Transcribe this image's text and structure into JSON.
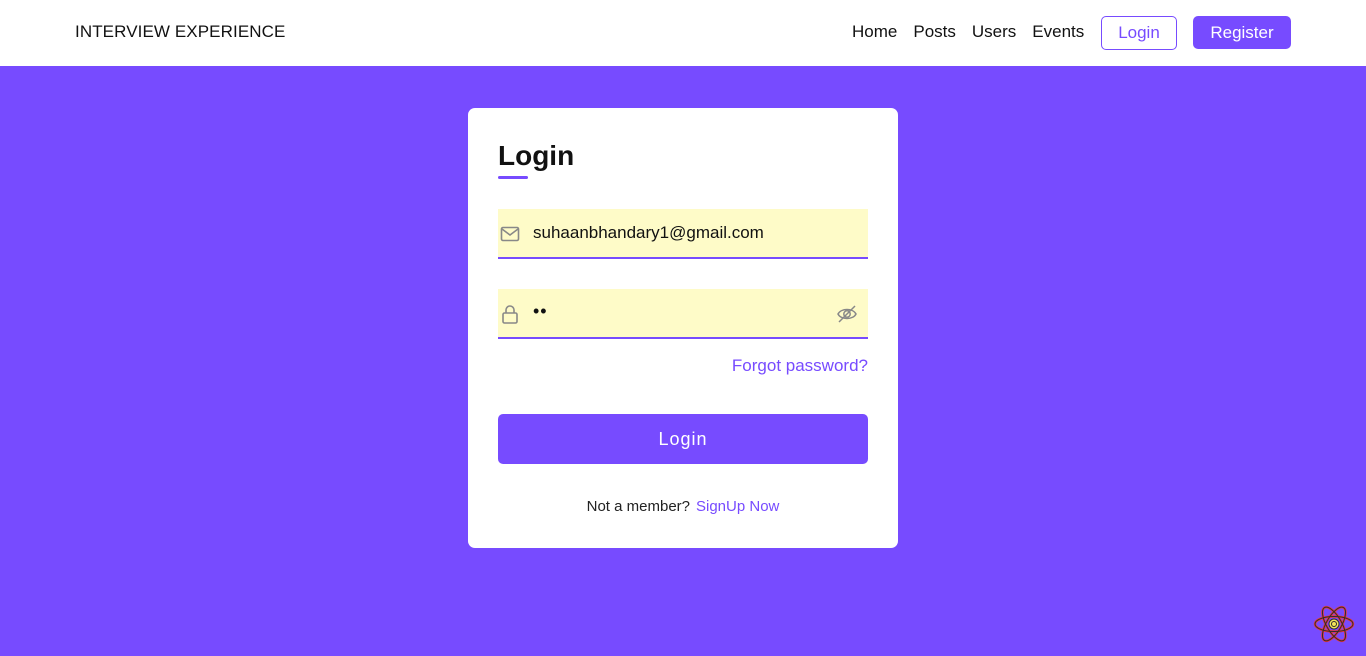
{
  "navbar": {
    "brand": "INTERVIEW EXPERIENCE",
    "links": [
      "Home",
      "Posts",
      "Users",
      "Events"
    ],
    "login_label": "Login",
    "register_label": "Register"
  },
  "login_card": {
    "title": "Login",
    "email_value": "suhaanbhandary1@gmail.com",
    "password_value": "••",
    "forgot_label": "Forgot password?",
    "submit_label": "Login",
    "not_member_text": "Not a member?",
    "signup_label": "SignUp Now"
  },
  "icons": {
    "email": "mail-icon",
    "password": "lock-icon",
    "toggle_visibility": "eye-slash-icon",
    "devtools": "react-devtools-icon"
  },
  "colors": {
    "accent": "#774bff",
    "input_bg": "#fefbc8",
    "card_bg": "#ffffff"
  }
}
